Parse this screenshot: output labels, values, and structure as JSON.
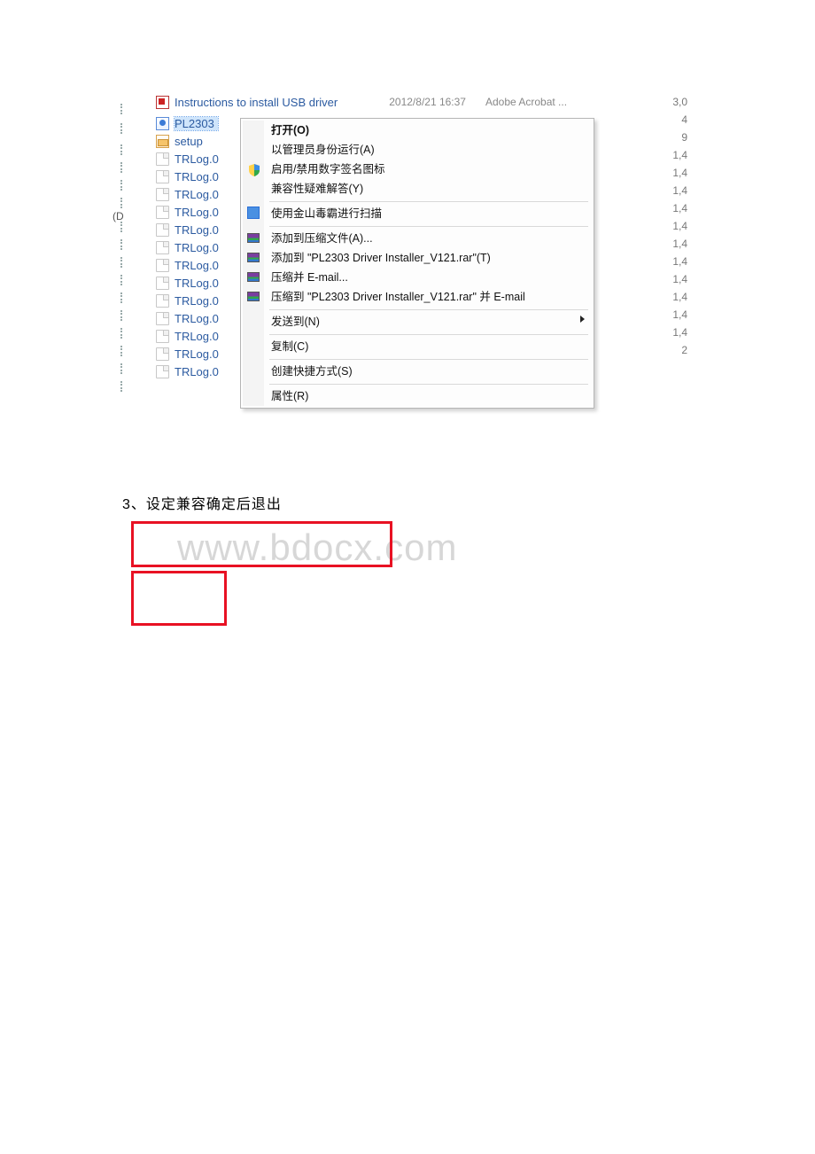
{
  "header_row": {
    "name": "Instructions to install USB driver",
    "date": "2012/8/21 16:37",
    "app": "Adobe Acrobat ...",
    "size": "3"
  },
  "files": [
    {
      "label": "PL2303",
      "icon": "installer",
      "selected": true
    },
    {
      "label": "setup",
      "icon": "setup"
    },
    {
      "label": "TRLog.0",
      "icon": "generic"
    },
    {
      "label": "TRLog.0",
      "icon": "generic"
    },
    {
      "label": "TRLog.0",
      "icon": "generic"
    },
    {
      "label": "TRLog.0",
      "icon": "generic"
    },
    {
      "label": "TRLog.0",
      "icon": "generic"
    },
    {
      "label": "TRLog.0",
      "icon": "generic"
    },
    {
      "label": "TRLog.0",
      "icon": "generic"
    },
    {
      "label": "TRLog.0",
      "icon": "generic"
    },
    {
      "label": "TRLog.0",
      "icon": "generic"
    },
    {
      "label": "TRLog.0",
      "icon": "generic"
    },
    {
      "label": "TRLog.0",
      "icon": "generic"
    },
    {
      "label": "TRLog.0",
      "icon": "generic"
    },
    {
      "label": "TRLog.0",
      "icon": "generic"
    }
  ],
  "sizes": [
    "3,0",
    "4",
    "9",
    "1,4",
    "1,4",
    "1,4",
    "1,4",
    "1,4",
    "1,4",
    "1,4",
    "1,4",
    "1,4",
    "1,4",
    "1,4",
    "2"
  ],
  "left_margin_label": "(D",
  "context_menu": {
    "items": [
      {
        "type": "item",
        "label": "打开(O)",
        "bold": true
      },
      {
        "type": "item",
        "label": "以管理员身份运行(A)",
        "icon": "shield"
      },
      {
        "type": "item",
        "label": "启用/禁用数字签名图标"
      },
      {
        "type": "item",
        "label": "兼容性疑难解答(Y)"
      },
      {
        "type": "sep"
      },
      {
        "type": "item",
        "label": "使用金山毒霸进行扫描",
        "icon": "jinshan"
      },
      {
        "type": "sep"
      },
      {
        "type": "item",
        "label": "添加到压缩文件(A)...",
        "icon": "rar"
      },
      {
        "type": "item",
        "label": "添加到 \"PL2303 Driver Installer_V121.rar\"(T)",
        "icon": "rar"
      },
      {
        "type": "item",
        "label": "压缩并 E-mail...",
        "icon": "rar"
      },
      {
        "type": "item",
        "label": "压缩到 \"PL2303 Driver Installer_V121.rar\" 并 E-mail",
        "icon": "rar"
      },
      {
        "type": "sep"
      },
      {
        "type": "item",
        "label": "发送到(N)",
        "submenu": true
      },
      {
        "type": "sep"
      },
      {
        "type": "item",
        "label": "复制(C)"
      },
      {
        "type": "sep"
      },
      {
        "type": "item",
        "label": "创建快捷方式(S)"
      },
      {
        "type": "sep"
      },
      {
        "type": "item",
        "label": "属性(R)"
      }
    ]
  },
  "step_text": "3、设定兼容确定后退出",
  "watermark": "www.bdocx.com"
}
